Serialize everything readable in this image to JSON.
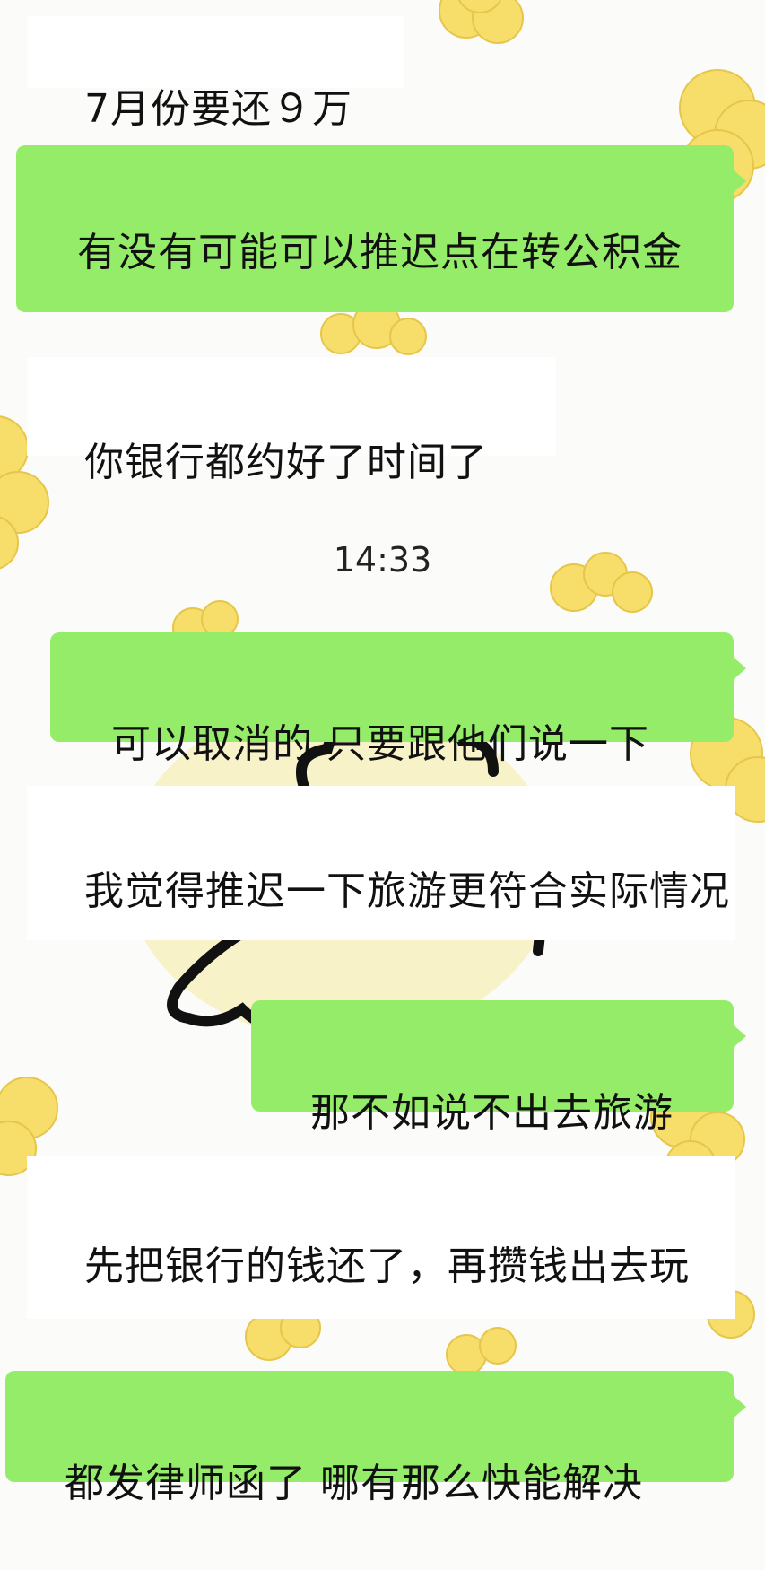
{
  "chat": {
    "colors": {
      "outgoing_bubble": "#95ec69",
      "incoming_bubble": "#ffffff",
      "background": "#fbfbf9",
      "sticker_yellow": "#f7dd6a"
    },
    "timestamp": "14:33",
    "messages": [
      {
        "id": "m1",
        "side": "incoming",
        "text": "7月份要还９万"
      },
      {
        "id": "m2",
        "side": "outgoing",
        "text": "有没有可能可以推迟点在转公积金"
      },
      {
        "id": "m3",
        "side": "incoming",
        "text": "你银行都约好了时间了"
      },
      {
        "id": "m4",
        "side": "outgoing",
        "text": "可以取消的 只要跟他们说一下"
      },
      {
        "id": "m5",
        "side": "incoming",
        "text": "我觉得推迟一下旅游更符合实际情况"
      },
      {
        "id": "m6",
        "side": "outgoing",
        "text": "那不如说不出去旅游"
      },
      {
        "id": "m7",
        "side": "incoming",
        "text": "先把银行的钱还了，再攒钱出去玩"
      },
      {
        "id": "m8",
        "side": "outgoing",
        "text": "都发律师函了 哪有那么快能解决"
      }
    ]
  }
}
